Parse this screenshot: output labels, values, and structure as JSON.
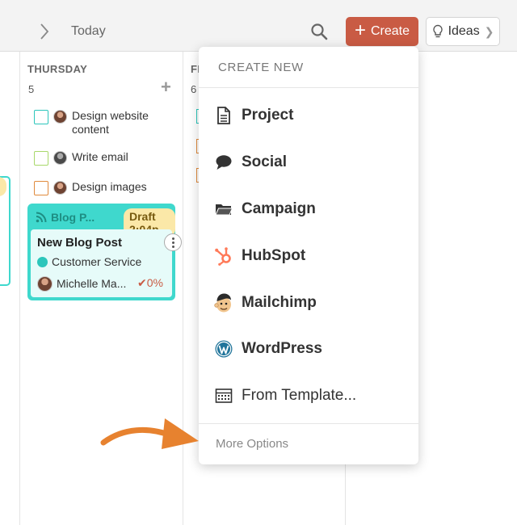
{
  "toolbar": {
    "today_label": "Today",
    "create_label": "Create",
    "ideas_label": "Ideas",
    "create_color": "#c95b44"
  },
  "calendar": {
    "thursday": {
      "name": "THURSDAY",
      "number": "5",
      "tasks": [
        {
          "label_line1": "Design website",
          "label_line2": "content",
          "checkbox_color": "#2cc6bb"
        },
        {
          "label": "Write email",
          "checkbox_color": "#a8d86a"
        },
        {
          "label": "Design images",
          "checkbox_color": "#e08a3c"
        }
      ],
      "card": {
        "type_label": "Blog P...",
        "status_badge": "Draft 2:04p",
        "title": "New Blog Post",
        "client": "Customer Service",
        "owner": "Michelle Ma...",
        "progress": "0%",
        "accent_color": "#3fd8cd"
      }
    },
    "friday": {
      "name_partial": "FI",
      "number": "6"
    }
  },
  "create_menu": {
    "header": "CREATE NEW",
    "items": [
      {
        "label": "Project",
        "icon": "document-icon"
      },
      {
        "label": "Social",
        "icon": "speech-bubble-icon"
      },
      {
        "label": "Campaign",
        "icon": "folder-icon"
      },
      {
        "label": "HubSpot",
        "icon": "hubspot-icon"
      },
      {
        "label": "Mailchimp",
        "icon": "mailchimp-icon"
      },
      {
        "label": "WordPress",
        "icon": "wordpress-icon"
      },
      {
        "label": "From Template...",
        "icon": "template-icon"
      }
    ],
    "footer": "More Options"
  },
  "annotation": {
    "arrow_color": "#e7822f"
  }
}
